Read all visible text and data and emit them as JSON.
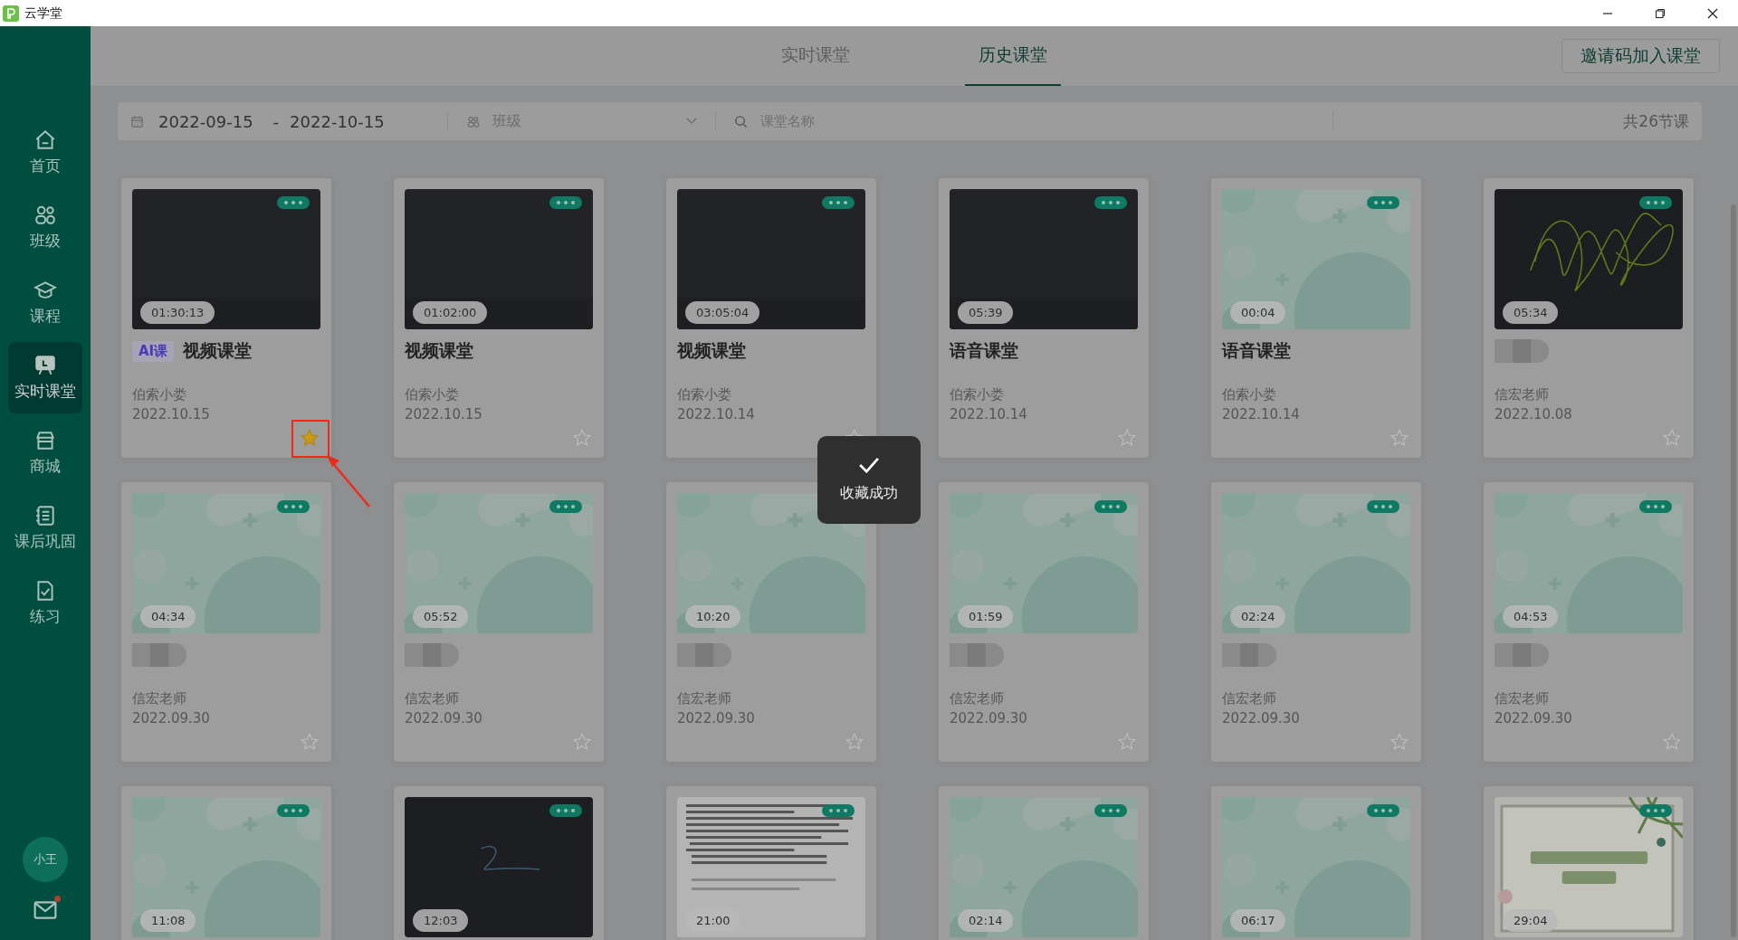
{
  "window": {
    "title": "云学堂"
  },
  "sidebar": {
    "items": [
      {
        "label": "首页",
        "selected": false
      },
      {
        "label": "班级",
        "selected": false
      },
      {
        "label": "课程",
        "selected": false
      },
      {
        "label": "实时课堂",
        "selected": true
      },
      {
        "label": "商城",
        "selected": false
      },
      {
        "label": "课后巩固",
        "selected": false
      },
      {
        "label": "练习",
        "selected": false
      }
    ],
    "avatar": "小王",
    "mail": {
      "unread": true
    }
  },
  "tabs": [
    {
      "label": "实时课堂",
      "selected": false
    },
    {
      "label": "历史课堂",
      "selected": true
    }
  ],
  "join_button": "邀请码加入课堂",
  "filter": {
    "date_start": "2022-09-15",
    "date_separator": "-",
    "date_end": "2022-10-15",
    "class_placeholder": "班级",
    "search_placeholder": "课堂名称",
    "count": "共26节课"
  },
  "cards": [
    [
      {
        "kind": "dark",
        "duration": "01:30:13",
        "ai": "AI课",
        "title": "视频课堂",
        "redacted": false,
        "teacher": "伯索小娄",
        "date": "2022.10.15",
        "starred": true,
        "annotated": true
      },
      {
        "kind": "dark",
        "duration": "01:02:00",
        "title": "视频课堂",
        "redacted": false,
        "teacher": "伯索小娄",
        "date": "2022.10.15",
        "starred": false,
        "annotated": false
      },
      {
        "kind": "dark",
        "duration": "03:05:04",
        "title": "视频课堂",
        "redacted": false,
        "teacher": "伯索小娄",
        "date": "2022.10.14",
        "starred": false,
        "annotated": false
      },
      {
        "kind": "dark",
        "duration": "05:39",
        "title": "语音课堂",
        "redacted": false,
        "teacher": "伯索小娄",
        "date": "2022.10.14",
        "starred": false,
        "annotated": false
      },
      {
        "kind": "green",
        "duration": "00:04",
        "title": "语音课堂",
        "redacted": false,
        "teacher": "伯索小娄",
        "date": "2022.10.14",
        "starred": false,
        "annotated": false
      },
      {
        "kind": "scribble",
        "duration": "05:34",
        "redacted": true,
        "teacher": "信宏老师",
        "date": "2022.10.08",
        "starred": false,
        "annotated": false
      }
    ],
    [
      {
        "kind": "green",
        "duration": "04:34",
        "redacted": true,
        "teacher": "信宏老师",
        "date": "2022.09.30",
        "starred": false,
        "annotated": false
      },
      {
        "kind": "green",
        "duration": "05:52",
        "redacted": true,
        "teacher": "信宏老师",
        "date": "2022.09.30",
        "starred": false,
        "annotated": false
      },
      {
        "kind": "green",
        "duration": "10:20",
        "redacted": true,
        "teacher": "信宏老师",
        "date": "2022.09.30",
        "starred": false,
        "annotated": false
      },
      {
        "kind": "green",
        "duration": "01:59",
        "redacted": true,
        "teacher": "信宏老师",
        "date": "2022.09.30",
        "starred": false,
        "annotated": false
      },
      {
        "kind": "green",
        "duration": "02:24",
        "redacted": true,
        "teacher": "信宏老师",
        "date": "2022.09.30",
        "starred": false,
        "annotated": false
      },
      {
        "kind": "green",
        "duration": "04:53",
        "redacted": true,
        "teacher": "信宏老师",
        "date": "2022.09.30",
        "starred": false,
        "annotated": false
      }
    ],
    [
      {
        "kind": "green",
        "duration": "11:08"
      },
      {
        "kind": "sketch",
        "duration": "12:03"
      },
      {
        "kind": "document",
        "duration": "21:00"
      },
      {
        "kind": "green",
        "duration": "02:14"
      },
      {
        "kind": "green",
        "duration": "06:17"
      },
      {
        "kind": "poster",
        "duration": "29:04"
      }
    ]
  ],
  "toast": {
    "message": "收藏成功"
  }
}
